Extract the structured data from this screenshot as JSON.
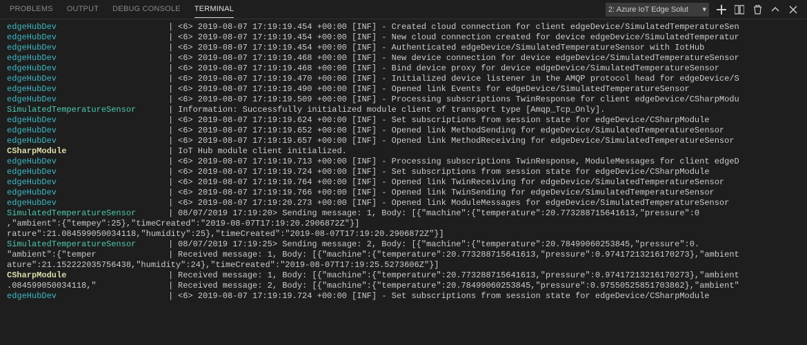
{
  "tabs": {
    "problems": "PROBLEMS",
    "output": "OUTPUT",
    "debug": "DEBUG CONSOLE",
    "terminal": "TERMINAL"
  },
  "selector": {
    "label": "2: Azure IoT Edge Solut"
  },
  "classes": {
    "edgeHubDev": "c-cyan",
    "SimulatedTemperatureSensor": "c-green",
    "CSharpModule": "c-yellow"
  },
  "rows": [
    {
      "src": "edgeHubDev",
      "msg": "<6> 2019-08-07 17:19:19.454 +00:00 [INF] - Created cloud connection for client edgeDevice/SimulatedTemperatureSen"
    },
    {
      "src": "edgeHubDev",
      "msg": "<6> 2019-08-07 17:19:19.454 +00:00 [INF] - New cloud connection created for device edgeDevice/SimulatedTemperatur"
    },
    {
      "src": "edgeHubDev",
      "msg": "<6> 2019-08-07 17:19:19.454 +00:00 [INF] - Authenticated edgeDevice/SimulatedTemperatureSensor with IotHub"
    },
    {
      "src": "edgeHubDev",
      "msg": "<6> 2019-08-07 17:19:19.468 +00:00 [INF] - New device connection for device edgeDevice/SimulatedTemperatureSensor"
    },
    {
      "src": "edgeHubDev",
      "msg": "<6> 2019-08-07 17:19:19.468 +00:00 [INF] - Bind device proxy for device edgeDevice/SimulatedTemperatureSensor"
    },
    {
      "src": "edgeHubDev",
      "msg": "<6> 2019-08-07 17:19:19.470 +00:00 [INF] - Initialized device listener in the AMQP protocol head for edgeDevice/S"
    },
    {
      "src": "edgeHubDev",
      "msg": "<6> 2019-08-07 17:19:19.490 +00:00 [INF] - Opened link Events for edgeDevice/SimulatedTemperatureSensor"
    },
    {
      "src": "edgeHubDev",
      "msg": "<6> 2019-08-07 17:19:19.509 +00:00 [INF] - Processing subscriptions TwinResponse for client edgeDevice/CSharpModu"
    },
    {
      "src": "SimulatedTemperatureSensor",
      "msg": "Information: Successfully initialized module client of transport type [Amqp_Tcp_Only]."
    },
    {
      "src": "edgeHubDev",
      "msg": "<6> 2019-08-07 17:19:19.624 +00:00 [INF] - Set subscriptions from session state for edgeDevice/CSharpModule"
    },
    {
      "src": "edgeHubDev",
      "msg": "<6> 2019-08-07 17:19:19.652 +00:00 [INF] - Opened link MethodSending for edgeDevice/SimulatedTemperatureSensor"
    },
    {
      "src": "edgeHubDev",
      "msg": "<6> 2019-08-07 17:19:19.657 +00:00 [INF] - Opened link MethodReceiving for edgeDevice/SimulatedTemperatureSensor"
    },
    {
      "src": "CSharpModule",
      "msg": "IoT Hub module client initialized."
    },
    {
      "src": "edgeHubDev",
      "msg": "<6> 2019-08-07 17:19:19.713 +00:00 [INF] - Processing subscriptions TwinResponse, ModuleMessages for client edgeD"
    },
    {
      "src": "edgeHubDev",
      "msg": "<6> 2019-08-07 17:19:19.724 +00:00 [INF] - Set subscriptions from session state for edgeDevice/CSharpModule"
    },
    {
      "src": "edgeHubDev",
      "msg": "<6> 2019-08-07 17:19:19.764 +00:00 [INF] - Opened link TwinReceiving for edgeDevice/SimulatedTemperatureSensor"
    },
    {
      "src": "edgeHubDev",
      "msg": "<6> 2019-08-07 17:19:19.766 +00:00 [INF] - Opened link TwinSending for edgeDevice/SimulatedTemperatureSensor"
    },
    {
      "src": "edgeHubDev",
      "msg": "<6> 2019-08-07 17:19:20.273 +00:00 [INF] - Opened link ModuleMessages for edgeDevice/SimulatedTemperatureSensor"
    },
    {
      "src": "SimulatedTemperatureSensor",
      "msg": "        08/07/2019 17:19:20> Sending message: 1, Body: [{\"machine\":{\"temperature\":20.773288715641613,\"pressure\":0",
      "wrap": ",\"ambient\":{\"tempey\":25},\"timeCreated\":\"2019-08-07T17:19:20.2906872Z\"}]"
    },
    {
      "src": "",
      "msg": "",
      "wrap": "rature\":21.084599050034118,\"humidity\":25},\"timeCreated\":\"2019-08-07T17:19:20.2906872Z\"}]"
    },
    {
      "src": "SimulatedTemperatureSensor",
      "msg": "        08/07/2019 17:19:25> Sending message: 2, Body: [{\"machine\":{\"temperature\":20.78499060253845,\"pressure\":0."
    },
    {
      "src": "\"ambient\":{\"temper",
      "srcPlain": true,
      "msg": "Received message: 1, Body: [{\"machine\":{\"temperature\":20.773288715641613,\"pressure\":0.97417213216170273},\"ambient",
      "wrap": "ature\":21.152222035756438,\"humidity\":24},\"timeCreated\":\"2019-08-07T17:19:25.5273606Z\"}]"
    },
    {
      "src": "CSharpModule",
      "msg": "Received message: 1, Body: [{\"machine\":{\"temperature\":20.773288715641613,\"pressure\":0.97417213216170273},\"ambient"
    },
    {
      "src": ".084599050034118,\"",
      "srcPlain": true,
      "msg": "Received message: 2, Body: [{\"machine\":{\"temperature\":20.78499060253845,\"pressure\":0.97550525851703862},\"ambient\""
    },
    {
      "src": "edgeHubDev",
      "msg": "<6> 2019-08-07 17:19:19.724 +00:00 [INF] - Set subscriptions from session state for edgeDevice/CSharpModule"
    }
  ]
}
